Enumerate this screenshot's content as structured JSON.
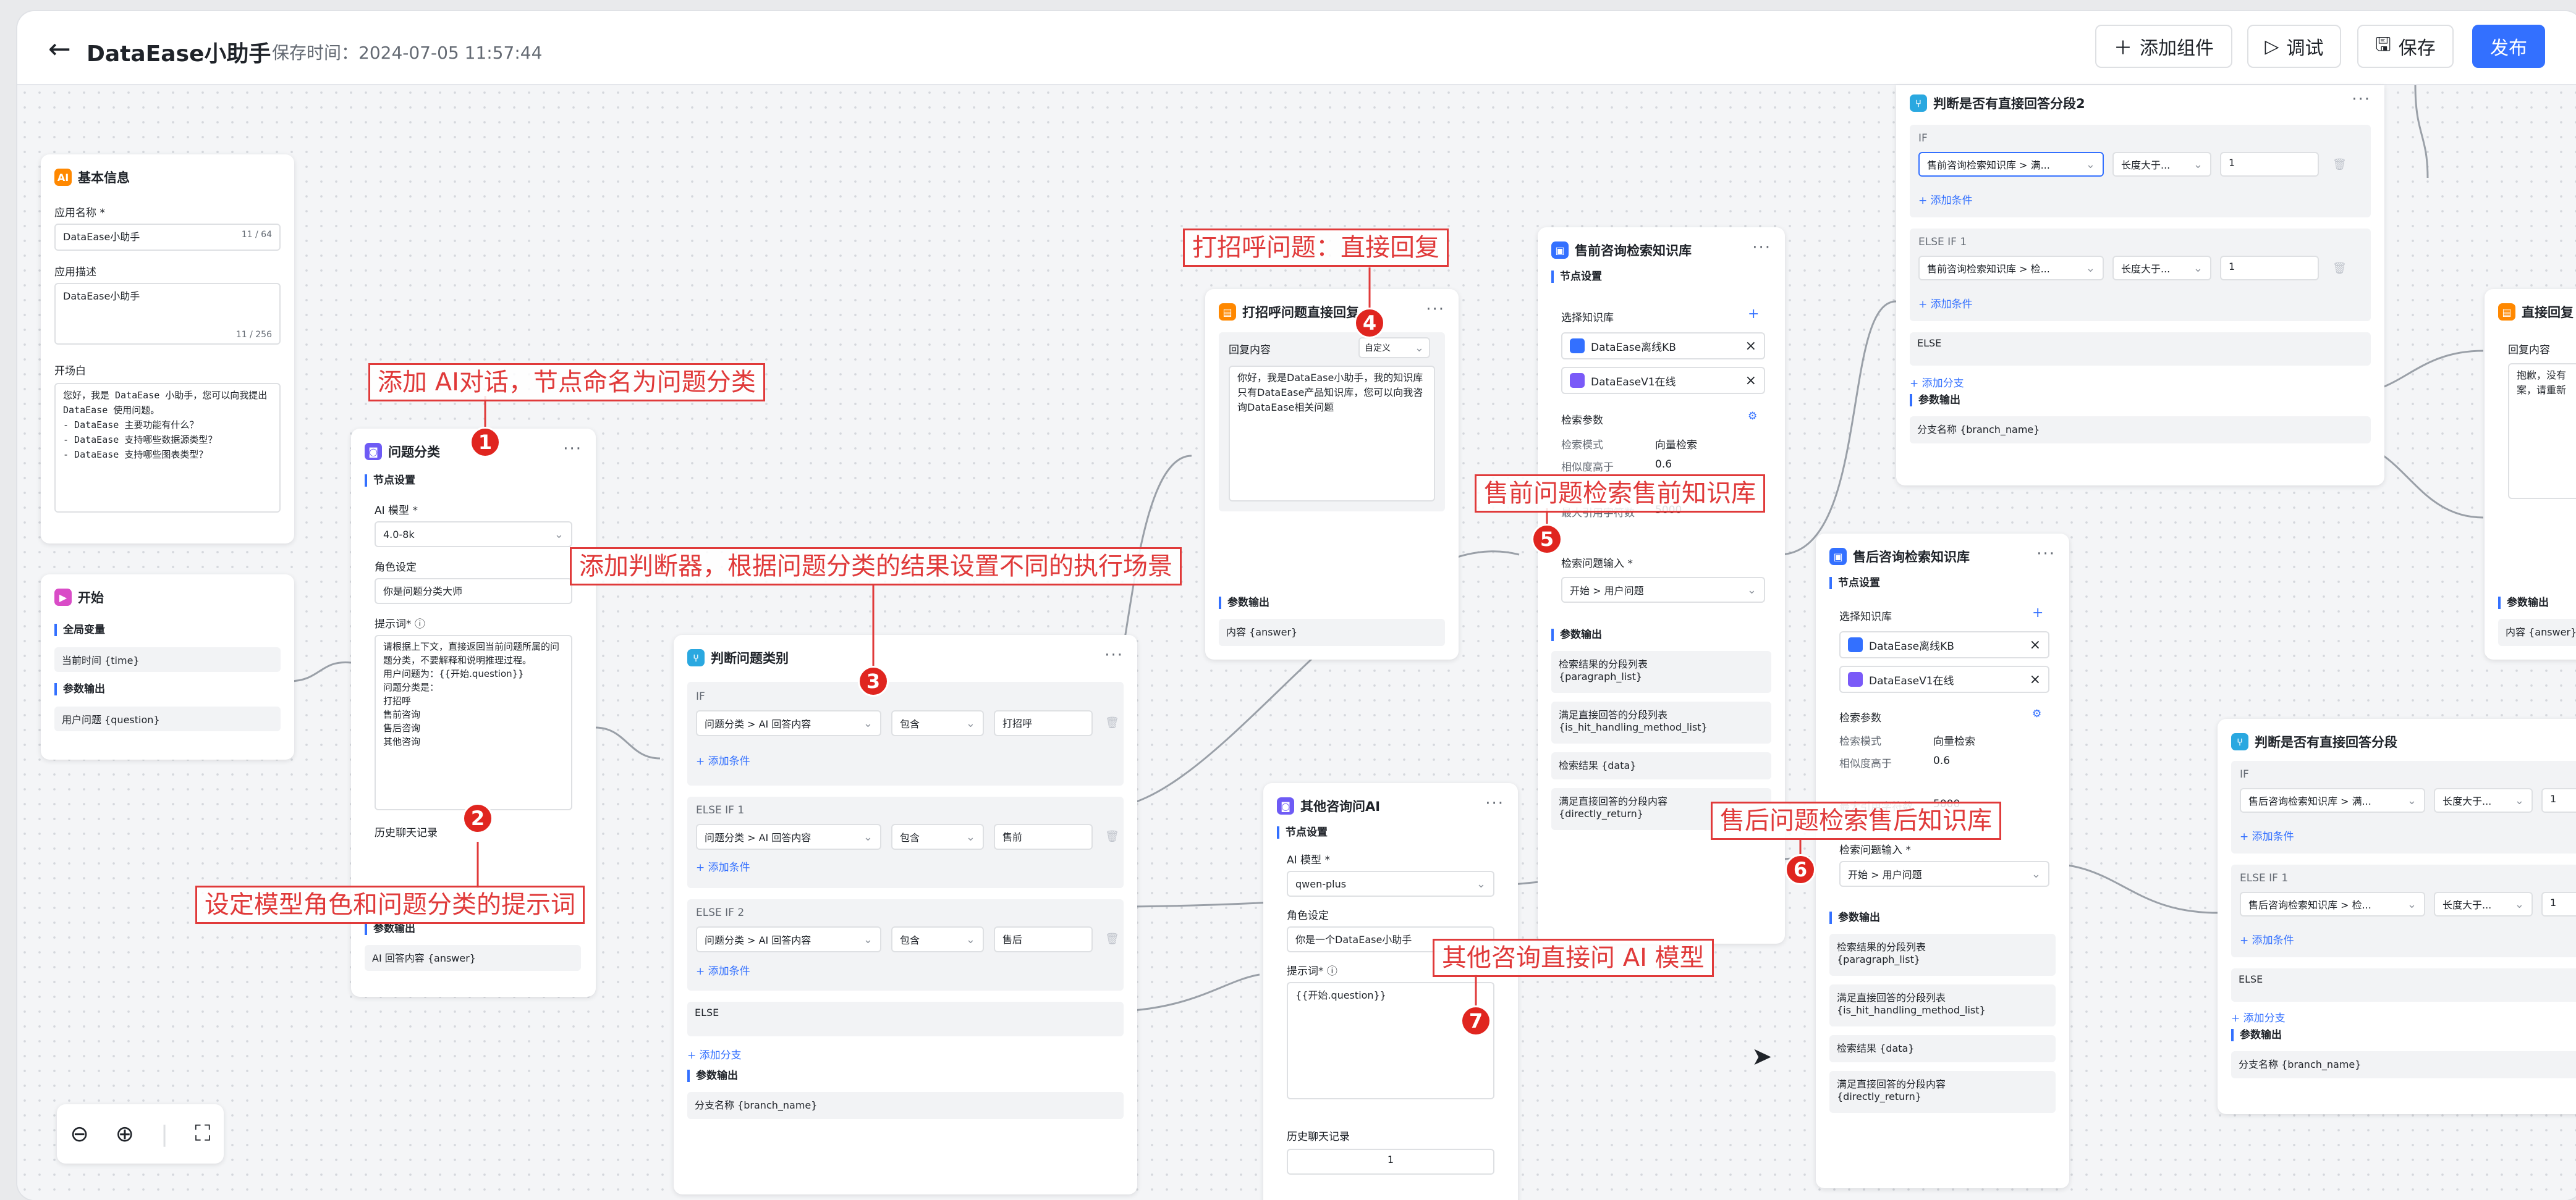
{
  "header": {
    "back_icon": "arrow-left-icon",
    "title": "DataEase小助手",
    "save_time": "保存时间：2024-07-05 11:57:44",
    "add_component": "添加组件",
    "debug": "调试",
    "save": "保存",
    "publish": "发布"
  },
  "colors": {
    "primary": "#3370ff",
    "annotation": "#e03a3a"
  },
  "basic_info": {
    "title": "基本信息",
    "app_name_label": "应用名称 *",
    "app_name_value": "DataEase小助手",
    "app_name_count": "11 / 64",
    "app_desc_label": "应用描述",
    "app_desc_value": "DataEase小助手",
    "app_desc_count": "11 / 256",
    "opening_label": "开场白",
    "opening_text": "您好，我是 DataEase 小助手，您可以向我提出 DataEase 使用问题。\n- DataEase 主要功能有什么？\n- DataEase 支持哪些数据源类型？\n- DataEase 支持哪些图表类型？"
  },
  "start_node": {
    "title": "开始",
    "global_vars": "全局变量",
    "time_var": "当前时间 {time}",
    "output_label": "参数输出",
    "question_var": "用户问题 {question}"
  },
  "classify_node": {
    "title": "问题分类",
    "node_settings": "节点设置",
    "ai_model_label": "AI 模型 *",
    "ai_model_value": "4.0-8k",
    "role_label": "角色设定",
    "role_value": "你是问题分类大师",
    "prompt_label": "提示词* ⓘ",
    "prompt_value": "请根据上下文，直接返回当前问题所属的问题分类，不要解释和说明推理过程。\n用户问题为：{{开始.question}}\n问题分类是：\n打招呼\n售前咨询\n售后咨询\n其他咨询",
    "history_label": "历史聊天记录",
    "output_label": "参数输出",
    "output_value": "AI 回答内容 {answer}"
  },
  "judge_node": {
    "title": "判断问题类别",
    "if_label": "IF",
    "var_value": "问题分类 > AI 回答内容",
    "op_value": "包含",
    "if_value": "打招呼",
    "add_condition": "+ 添加条件",
    "elseif1_label": "ELSE IF 1",
    "elseif1_value": "售前",
    "elseif2_label": "ELSE IF 2",
    "elseif2_value": "售后",
    "else_label": "ELSE",
    "add_branch": "+ 添加分支",
    "output_label": "参数输出",
    "output_value": "分支名称 {branch_name}"
  },
  "greet_node": {
    "title": "打招呼问题直接回复",
    "content_label": "回复内容",
    "mode_value": "自定义",
    "content_value": "你好，我是DataEase小助手，我的知识库只有DataEase产品知识库，您可以向我咨询DataEase相关问题",
    "output_label": "参数输出",
    "output_value": "内容 {answer}"
  },
  "other_node": {
    "title": "其他咨询问AI",
    "node_settings": "节点设置",
    "ai_model_label": "AI 模型 *",
    "ai_model_value": "qwen-plus",
    "role_label": "角色设定",
    "role_value": "你是一个DataEase小助手",
    "prompt_label": "提示词* ⓘ",
    "prompt_value": "{{开始.question}}",
    "history_label": "历史聊天记录",
    "history_value": "1"
  },
  "presale_node": {
    "title": "售前咨询检索知识库",
    "node_settings": "节点设置",
    "select_kb": "选择知识库",
    "kb1": "DataEase离线KB",
    "kb2": "DataEaseV1在线",
    "search_params": "检索参数",
    "mode_label": "检索模式",
    "mode_value": "向量检索",
    "sim_label": "相似度高于",
    "sim_value": "0.6",
    "max_label": "最大引用字符数",
    "max_value": "5000",
    "input_label": "检索问题输入 *",
    "input_value": "开始 > 用户问题",
    "output_label": "参数输出",
    "out1": "检索结果的分段列表\n{paragraph_list}",
    "out2": "满足直接回答的分段列表\n{is_hit_handling_method_list}",
    "out3": "检索结果 {data}",
    "out4": "满足直接回答的分段内容\n{directly_return}"
  },
  "aftersale_node": {
    "title": "售后咨询检索知识库",
    "node_settings": "节点设置",
    "select_kb": "选择知识库",
    "kb1": "DataEase离线KB",
    "kb2": "DataEaseV1在线",
    "search_params": "检索参数",
    "mode_label": "检索模式",
    "mode_value": "向量检索",
    "sim_label": "相似度高于",
    "sim_value": "0.6",
    "max_label": "最大引用字符数",
    "max_value": "5000",
    "input_label": "检索问题输入 *",
    "input_value": "开始 > 用户问题",
    "output_label": "参数输出",
    "out1": "检索结果的分段列表\n{paragraph_list}",
    "out2": "满足直接回答的分段列表\n{is_hit_handling_method_list}",
    "out3": "检索结果 {data}",
    "out4": "满足直接回答的分段内容\n{directly_return}"
  },
  "judge2_node": {
    "title": "判断是否有直接回答分段2",
    "if_label": "IF",
    "if_var": "售前咨询检索知识库 > 满...",
    "op_value": "长度大于...",
    "num_value": "1",
    "add_condition": "+ 添加条件",
    "elseif_label": "ELSE IF 1",
    "elseif_var": "售前咨询检索知识库 > 检...",
    "else_label": "ELSE",
    "add_branch": "+ 添加分支",
    "output_label": "参数输出",
    "output_value": "分支名称 {branch_name}"
  },
  "judge3_node": {
    "title": "判断是否有直接回答分段",
    "if_label": "IF",
    "if_var": "售后咨询检索知识库 > 满...",
    "op_value": "长度大于...",
    "num_value": "1",
    "add_condition": "+ 添加条件",
    "elseif_label": "ELSE IF 1",
    "elseif_var": "售后咨询检索知识库 > 检...",
    "else_label": "ELSE",
    "add_branch": "+ 添加分支",
    "output_label": "参数输出",
    "output_value": "分支名称 {branch_name}"
  },
  "reply_node": {
    "title": "直接回复",
    "content_label": "回复内容",
    "content_value": "抱歉，没有\n案，请重新",
    "output_label": "参数输出",
    "output_value": "内容 {answer}"
  },
  "annotations": {
    "a1": "添加 AI对话，节点命名为问题分类",
    "a2": "设定模型角色和问题分类的提示词",
    "a3": "添加判断器，根据问题分类的结果设置不同的执行场景",
    "a4": "打招呼问题：直接回复",
    "a5": "售前问题检索售前知识库",
    "a6": "售后问题检索售后知识库",
    "a7": "其他咨询直接问 AI 模型",
    "n1": "1",
    "n2": "2",
    "n3": "3",
    "n4": "4",
    "n5": "5",
    "n6": "6",
    "n7": "7"
  },
  "zoom": {
    "out_icon": "zoom-out-icon",
    "in_icon": "zoom-in-icon",
    "fit_icon": "fit-view-icon"
  }
}
